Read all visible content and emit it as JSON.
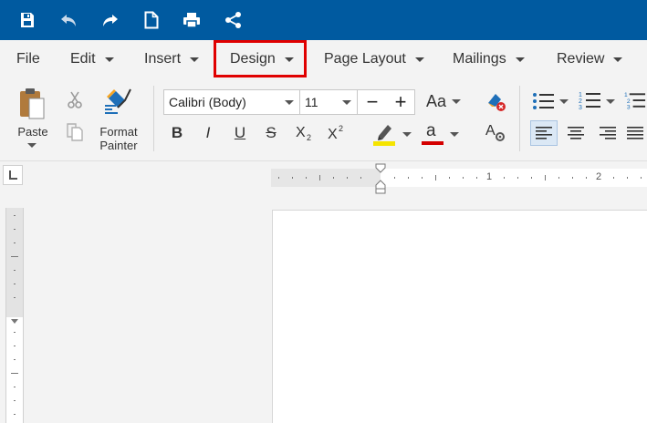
{
  "quick_access": {
    "icons": [
      "save-icon",
      "undo-icon",
      "redo-icon",
      "new-document-icon",
      "print-icon",
      "share-icon"
    ]
  },
  "menu": {
    "tabs": [
      {
        "label": "File",
        "has_dropdown": false
      },
      {
        "label": "Edit",
        "has_dropdown": true
      },
      {
        "label": "Insert",
        "has_dropdown": true
      },
      {
        "label": "Design",
        "has_dropdown": true
      },
      {
        "label": "Page Layout",
        "has_dropdown": true
      },
      {
        "label": "Mailings",
        "has_dropdown": true
      },
      {
        "label": "Review",
        "has_dropdown": true
      }
    ],
    "highlighted_tab": "Design"
  },
  "ribbon": {
    "paste_label": "Paste",
    "format_painter_label_line1": "Format",
    "format_painter_label_line2": "Painter",
    "font_family": "Calibri (Body)",
    "font_size": "11",
    "decrease_label": "−",
    "increase_label": "+",
    "change_case_label": "Aa",
    "bold_label": "B",
    "italic_label": "I",
    "underline_label": "U",
    "strike_label": "S",
    "highlight_color": "#f5e400",
    "font_color": "#d40000"
  },
  "ruler": {
    "h_numbers": [
      "1",
      "2"
    ]
  },
  "colors": {
    "accent": "#005aa0",
    "highlight_box": "#e00000"
  }
}
